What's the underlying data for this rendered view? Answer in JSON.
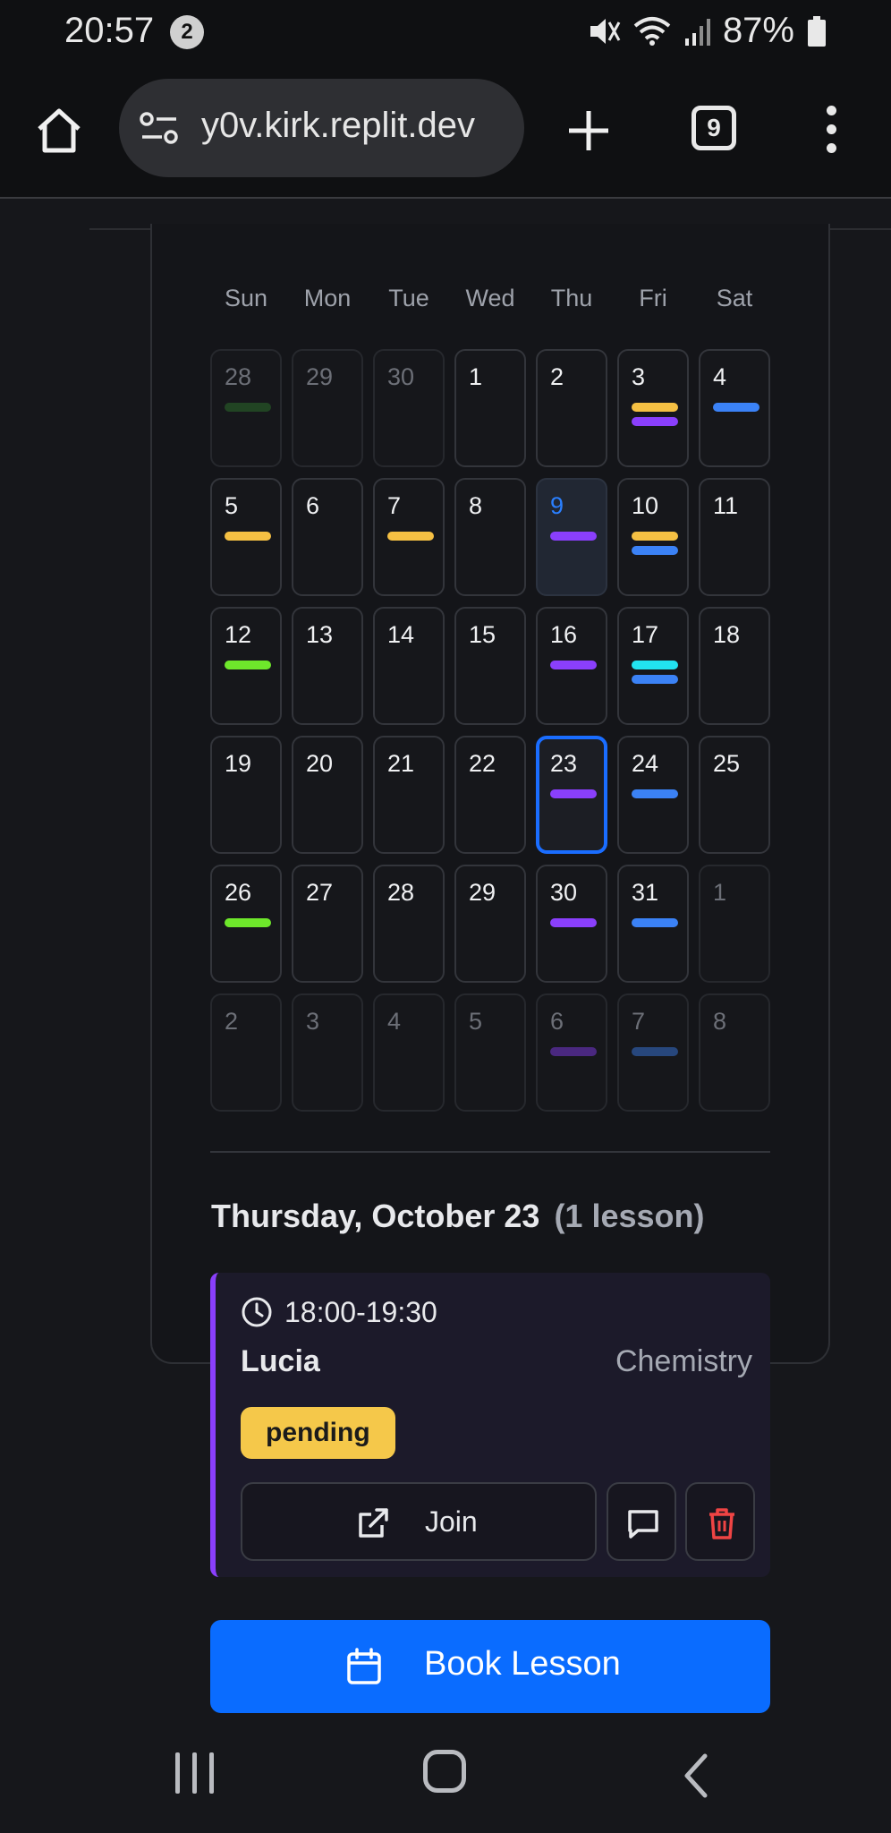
{
  "status_bar": {
    "time": "20:57",
    "notification_count": "2",
    "battery_percent": "87%",
    "icons": [
      "mute-icon",
      "wifi-icon",
      "signal-icon",
      "battery-icon"
    ]
  },
  "browser": {
    "url": "y0v.kirk.replit.dev",
    "tab_count": "9"
  },
  "calendar": {
    "weekdays": [
      "Sun",
      "Mon",
      "Tue",
      "Wed",
      "Thu",
      "Fri",
      "Sat"
    ],
    "today": "9",
    "selected": "23",
    "weeks": [
      [
        {
          "day": "28",
          "outside": true,
          "bars": [
            "#2f7d2f"
          ]
        },
        {
          "day": "29",
          "outside": true,
          "bars": []
        },
        {
          "day": "30",
          "outside": true,
          "bars": []
        },
        {
          "day": "1",
          "bars": []
        },
        {
          "day": "2",
          "bars": []
        },
        {
          "day": "3",
          "bars": [
            "#f5c043",
            "#8a3ffc"
          ]
        },
        {
          "day": "4",
          "bars": [
            "#3b82f6"
          ]
        }
      ],
      [
        {
          "day": "5",
          "bars": [
            "#f5c043"
          ]
        },
        {
          "day": "6",
          "bars": []
        },
        {
          "day": "7",
          "bars": [
            "#f5c043"
          ]
        },
        {
          "day": "8",
          "bars": []
        },
        {
          "day": "9",
          "today": true,
          "bars": [
            "#8a3ffc"
          ]
        },
        {
          "day": "10",
          "bars": [
            "#f5c043",
            "#3b82f6"
          ]
        },
        {
          "day": "11",
          "bars": []
        }
      ],
      [
        {
          "day": "12",
          "bars": [
            "#6ee72b"
          ]
        },
        {
          "day": "13",
          "bars": []
        },
        {
          "day": "14",
          "bars": []
        },
        {
          "day": "15",
          "bars": []
        },
        {
          "day": "16",
          "bars": [
            "#8a3ffc"
          ]
        },
        {
          "day": "17",
          "bars": [
            "#22e3f0",
            "#3b82f6"
          ]
        },
        {
          "day": "18",
          "bars": []
        }
      ],
      [
        {
          "day": "19",
          "bars": []
        },
        {
          "day": "20",
          "bars": []
        },
        {
          "day": "21",
          "bars": []
        },
        {
          "day": "22",
          "bars": []
        },
        {
          "day": "23",
          "selected": true,
          "bars": [
            "#8a3ffc"
          ]
        },
        {
          "day": "24",
          "bars": [
            "#3b82f6"
          ]
        },
        {
          "day": "25",
          "bars": []
        }
      ],
      [
        {
          "day": "26",
          "bars": [
            "#6ee72b"
          ]
        },
        {
          "day": "27",
          "bars": []
        },
        {
          "day": "28",
          "bars": []
        },
        {
          "day": "29",
          "bars": []
        },
        {
          "day": "30",
          "bars": [
            "#8a3ffc"
          ]
        },
        {
          "day": "31",
          "bars": [
            "#3b82f6"
          ]
        },
        {
          "day": "1",
          "outside": true,
          "bars": []
        }
      ],
      [
        {
          "day": "2",
          "outside": true,
          "bars": []
        },
        {
          "day": "3",
          "outside": true,
          "bars": []
        },
        {
          "day": "4",
          "outside": true,
          "bars": []
        },
        {
          "day": "5",
          "outside": true,
          "bars": []
        },
        {
          "day": "6",
          "outside": true,
          "bars": [
            "#8a3ffc"
          ]
        },
        {
          "day": "7",
          "outside": true,
          "bars": [
            "#3b82f6"
          ]
        },
        {
          "day": "8",
          "outside": true,
          "bars": []
        }
      ]
    ]
  },
  "selected_day": {
    "title": "Thursday, October 23",
    "count": "(1 lesson)"
  },
  "lesson": {
    "time": "18:00-19:30",
    "student": "Lucia",
    "subject": "Chemistry",
    "status": "pending",
    "accent_color": "#8a3ffc",
    "join_label": "Join"
  },
  "book_button": {
    "label": "Book Lesson"
  },
  "colors": {
    "primary": "#0a6cff",
    "background": "#16171b",
    "pending": "#f5c84a",
    "delete": "#ef4444"
  }
}
